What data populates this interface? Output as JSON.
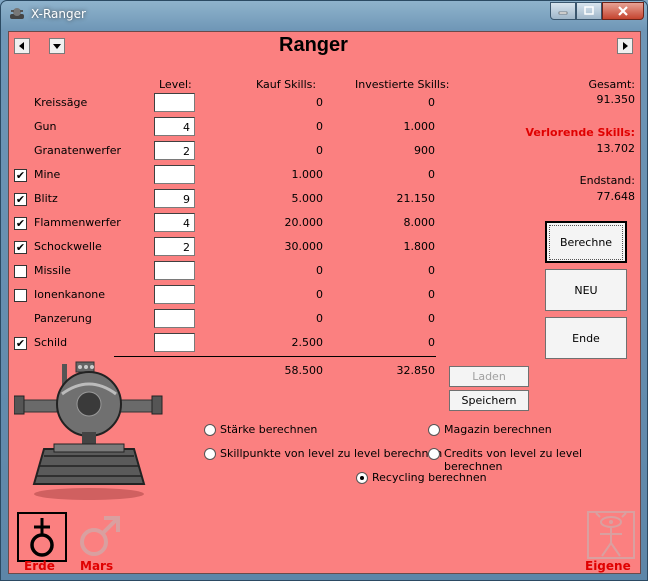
{
  "window": {
    "title": "X-Ranger"
  },
  "page": {
    "title": "Ranger"
  },
  "headers": {
    "level": "Level:",
    "kauf": "Kauf Skills:",
    "invest": "Investierte Skills:"
  },
  "rows": [
    {
      "name": "Kreissäge",
      "checkbox": false,
      "checked": false,
      "level": "",
      "kauf": "0",
      "invest": "0"
    },
    {
      "name": "Gun",
      "checkbox": false,
      "checked": false,
      "level": "4",
      "kauf": "0",
      "invest": "1.000"
    },
    {
      "name": "Granatenwerfer",
      "checkbox": false,
      "checked": false,
      "level": "2",
      "kauf": "0",
      "invest": "900"
    },
    {
      "name": "Mine",
      "checkbox": true,
      "checked": true,
      "level": "",
      "kauf": "1.000",
      "invest": "0"
    },
    {
      "name": "Blitz",
      "checkbox": true,
      "checked": true,
      "level": "9",
      "kauf": "5.000",
      "invest": "21.150"
    },
    {
      "name": "Flammenwerfer",
      "checkbox": true,
      "checked": true,
      "level": "4",
      "kauf": "20.000",
      "invest": "8.000"
    },
    {
      "name": "Schockwelle",
      "checkbox": true,
      "checked": true,
      "level": "2",
      "kauf": "30.000",
      "invest": "1.800"
    },
    {
      "name": "Missile",
      "checkbox": true,
      "checked": false,
      "level": "",
      "kauf": "0",
      "invest": "0"
    },
    {
      "name": "Ionenkanone",
      "checkbox": true,
      "checked": false,
      "level": "",
      "kauf": "0",
      "invest": "0"
    },
    {
      "name": "Panzerung",
      "checkbox": false,
      "checked": false,
      "level": "",
      "kauf": "0",
      "invest": "0"
    },
    {
      "name": "Schild",
      "checkbox": true,
      "checked": true,
      "level": "",
      "kauf": "2.500",
      "invest": "0"
    }
  ],
  "totals": {
    "kauf": "58.500",
    "invest": "32.850"
  },
  "summary": {
    "gesamt_label": "Gesamt:",
    "gesamt_value": "91.350",
    "verlorene_label": "Verlorende Skills:",
    "verlorene_value": "13.702",
    "endstand_label": "Endstand:",
    "endstand_value": "77.648"
  },
  "buttons": {
    "berechne": "Berechne",
    "neu": "NEU",
    "ende": "Ende",
    "laden": "Laden",
    "speichern": "Speichern"
  },
  "radios": {
    "staerke": "Stärke berechnen",
    "skillpunkte": "Skillpunkte von level zu level berechnen",
    "recycling": "Recycling berechnen",
    "magazin": "Magazin berechnen",
    "credits": "Credits von level zu level berechnen"
  },
  "planets": {
    "erde": "Erde",
    "mars": "Mars",
    "eigene": "Eigene"
  },
  "colors": {
    "background": "#fb8080",
    "accent_red": "#e00000"
  }
}
